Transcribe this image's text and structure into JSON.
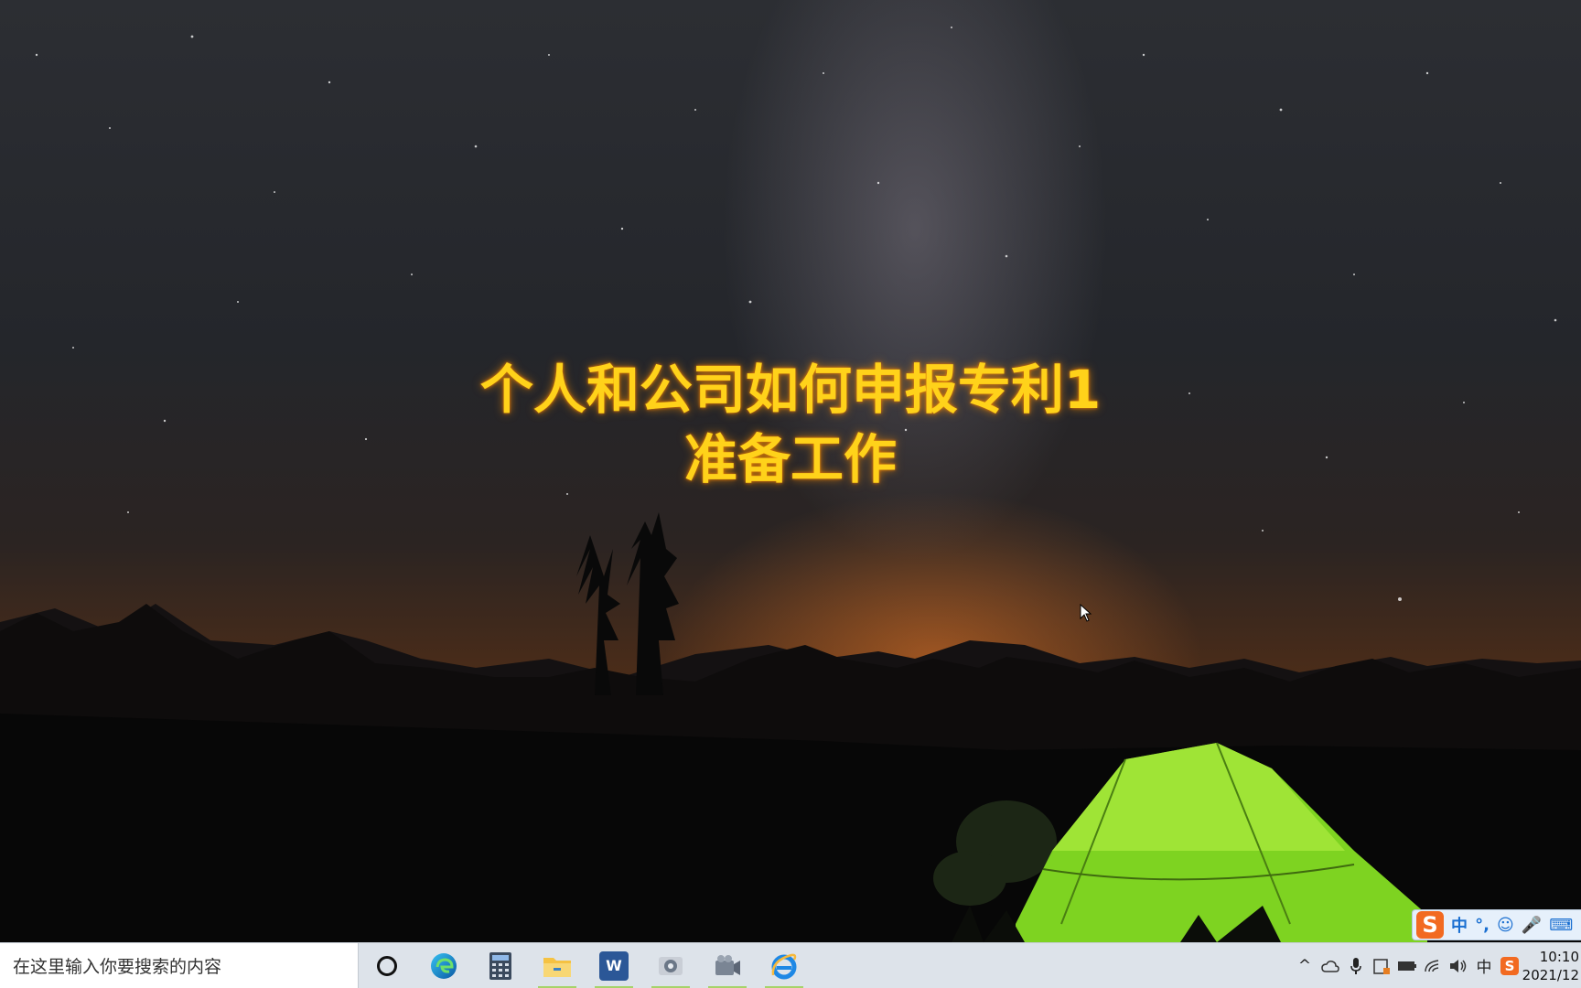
{
  "overlay": {
    "title_line1": "个人和公司如何申报专利1",
    "title_line2": "准备工作"
  },
  "ime_bar": {
    "logo": "S",
    "mode_label": "中",
    "punct_label": "°,",
    "emoji_label": "☺",
    "mic_label": "🎤",
    "keyboard_label": "⌨"
  },
  "taskbar": {
    "search_placeholder": "在这里输入你要搜索的内容",
    "apps": [
      {
        "name": "edge",
        "running": false
      },
      {
        "name": "calculator",
        "running": false
      },
      {
        "name": "file-explorer",
        "running": true
      },
      {
        "name": "word",
        "label": "W",
        "running": true
      },
      {
        "name": "app-5",
        "running": true
      },
      {
        "name": "app-6",
        "running": true
      },
      {
        "name": "internet-explorer",
        "running": true
      }
    ],
    "tray": {
      "chevron": "^",
      "ime_mode": "中",
      "sogou_logo": "S"
    },
    "clock": {
      "time": "10:10",
      "date": "2021/12"
    }
  },
  "colors": {
    "overlay_text": "#ffd21a",
    "taskbar_bg": "#dde3ea",
    "running_indicator": "#a6d36a",
    "ime_accent": "#1a6fd1",
    "sogou_orange": "#f26a21"
  }
}
